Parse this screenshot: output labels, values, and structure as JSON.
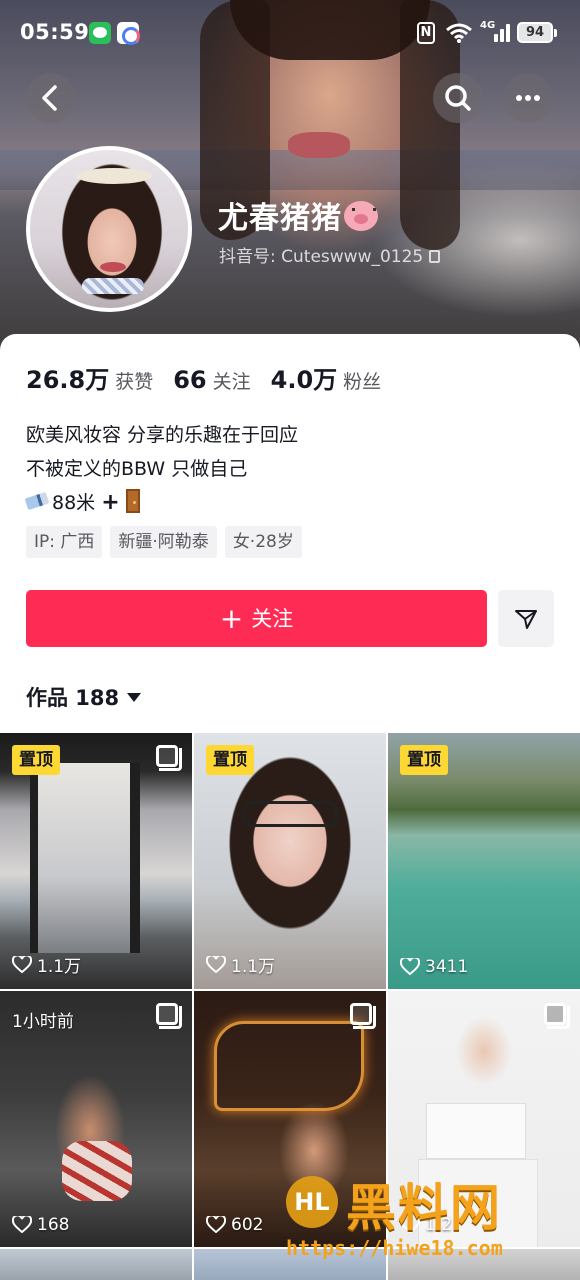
{
  "status_bar": {
    "time": "05:59",
    "network": "4G",
    "battery": "94"
  },
  "profile": {
    "nickname": "尤春猪猪",
    "douyin_id": "抖音号: Cuteswww_0125",
    "stats": [
      {
        "value": "26.8万",
        "label": "获赞"
      },
      {
        "value": "66",
        "label": "关注"
      },
      {
        "value": "4.0万",
        "label": "粉丝"
      }
    ],
    "bio_line1": "欧美风妆容 分享的乐趣在于回应",
    "bio_line2": "不被定义的BBW 只做自己",
    "bio_line3_text": "88米",
    "tags": [
      "IP: 广西",
      "新疆·阿勒泰",
      "女·28岁"
    ]
  },
  "actions": {
    "follow_label": "关注",
    "follow_color": "#fe2c55"
  },
  "works": {
    "tab_label": "作品 188"
  },
  "grid": {
    "pinned_label": "置顶",
    "tiles": [
      {
        "likes": "1.1万",
        "pinned": true
      },
      {
        "likes": "1.1万",
        "pinned": true
      },
      {
        "likes": "3411",
        "pinned": true
      },
      {
        "likes": "168",
        "time": "1小时前"
      },
      {
        "likes": "602"
      },
      {
        "likes": "1.2"
      }
    ]
  },
  "watermark": {
    "logo": "HL",
    "name": "黑料网",
    "url": "https://hiwe18.com"
  },
  "icons": [
    "back-icon",
    "search-icon",
    "more-icon",
    "copy-icon",
    "send-icon",
    "heart-icon",
    "multi-image-icon",
    "caret-down-icon"
  ]
}
